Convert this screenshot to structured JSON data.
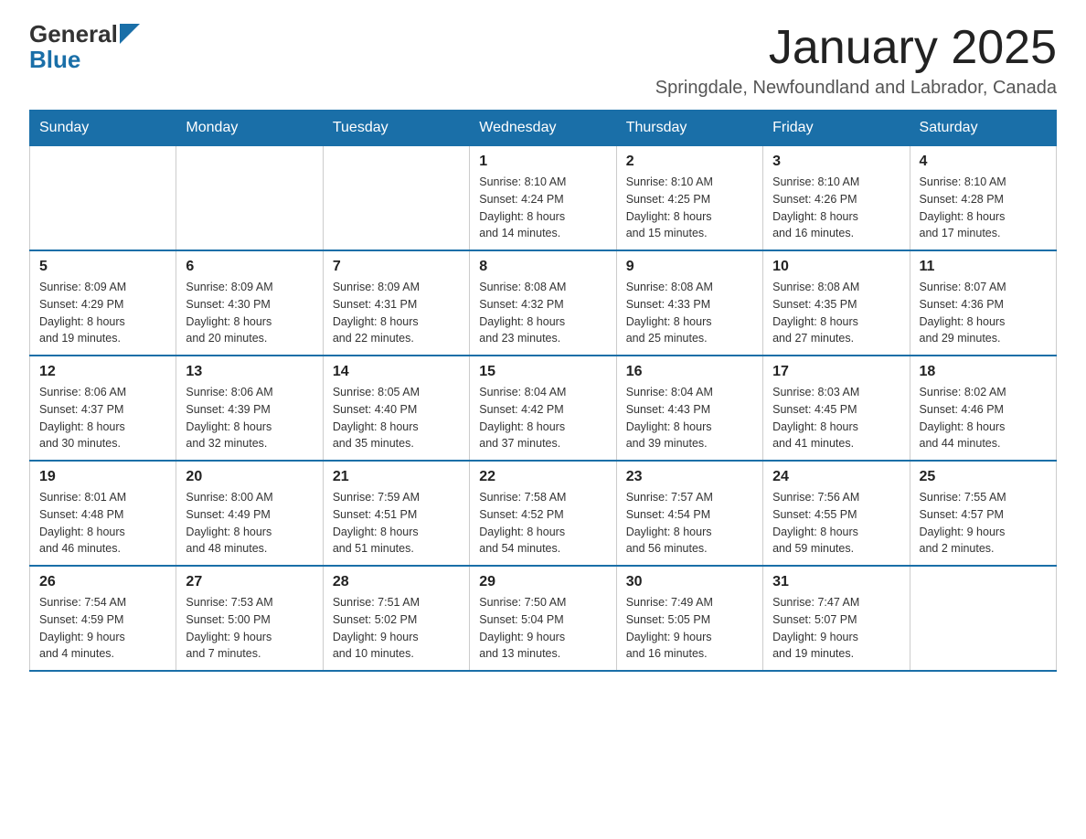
{
  "header": {
    "logo_general": "General",
    "logo_blue": "Blue",
    "month_title": "January 2025",
    "location": "Springdale, Newfoundland and Labrador, Canada"
  },
  "days_of_week": [
    "Sunday",
    "Monday",
    "Tuesday",
    "Wednesday",
    "Thursday",
    "Friday",
    "Saturday"
  ],
  "weeks": [
    {
      "days": [
        {
          "number": "",
          "info": ""
        },
        {
          "number": "",
          "info": ""
        },
        {
          "number": "",
          "info": ""
        },
        {
          "number": "1",
          "info": "Sunrise: 8:10 AM\nSunset: 4:24 PM\nDaylight: 8 hours\nand 14 minutes."
        },
        {
          "number": "2",
          "info": "Sunrise: 8:10 AM\nSunset: 4:25 PM\nDaylight: 8 hours\nand 15 minutes."
        },
        {
          "number": "3",
          "info": "Sunrise: 8:10 AM\nSunset: 4:26 PM\nDaylight: 8 hours\nand 16 minutes."
        },
        {
          "number": "4",
          "info": "Sunrise: 8:10 AM\nSunset: 4:28 PM\nDaylight: 8 hours\nand 17 minutes."
        }
      ]
    },
    {
      "days": [
        {
          "number": "5",
          "info": "Sunrise: 8:09 AM\nSunset: 4:29 PM\nDaylight: 8 hours\nand 19 minutes."
        },
        {
          "number": "6",
          "info": "Sunrise: 8:09 AM\nSunset: 4:30 PM\nDaylight: 8 hours\nand 20 minutes."
        },
        {
          "number": "7",
          "info": "Sunrise: 8:09 AM\nSunset: 4:31 PM\nDaylight: 8 hours\nand 22 minutes."
        },
        {
          "number": "8",
          "info": "Sunrise: 8:08 AM\nSunset: 4:32 PM\nDaylight: 8 hours\nand 23 minutes."
        },
        {
          "number": "9",
          "info": "Sunrise: 8:08 AM\nSunset: 4:33 PM\nDaylight: 8 hours\nand 25 minutes."
        },
        {
          "number": "10",
          "info": "Sunrise: 8:08 AM\nSunset: 4:35 PM\nDaylight: 8 hours\nand 27 minutes."
        },
        {
          "number": "11",
          "info": "Sunrise: 8:07 AM\nSunset: 4:36 PM\nDaylight: 8 hours\nand 29 minutes."
        }
      ]
    },
    {
      "days": [
        {
          "number": "12",
          "info": "Sunrise: 8:06 AM\nSunset: 4:37 PM\nDaylight: 8 hours\nand 30 minutes."
        },
        {
          "number": "13",
          "info": "Sunrise: 8:06 AM\nSunset: 4:39 PM\nDaylight: 8 hours\nand 32 minutes."
        },
        {
          "number": "14",
          "info": "Sunrise: 8:05 AM\nSunset: 4:40 PM\nDaylight: 8 hours\nand 35 minutes."
        },
        {
          "number": "15",
          "info": "Sunrise: 8:04 AM\nSunset: 4:42 PM\nDaylight: 8 hours\nand 37 minutes."
        },
        {
          "number": "16",
          "info": "Sunrise: 8:04 AM\nSunset: 4:43 PM\nDaylight: 8 hours\nand 39 minutes."
        },
        {
          "number": "17",
          "info": "Sunrise: 8:03 AM\nSunset: 4:45 PM\nDaylight: 8 hours\nand 41 minutes."
        },
        {
          "number": "18",
          "info": "Sunrise: 8:02 AM\nSunset: 4:46 PM\nDaylight: 8 hours\nand 44 minutes."
        }
      ]
    },
    {
      "days": [
        {
          "number": "19",
          "info": "Sunrise: 8:01 AM\nSunset: 4:48 PM\nDaylight: 8 hours\nand 46 minutes."
        },
        {
          "number": "20",
          "info": "Sunrise: 8:00 AM\nSunset: 4:49 PM\nDaylight: 8 hours\nand 48 minutes."
        },
        {
          "number": "21",
          "info": "Sunrise: 7:59 AM\nSunset: 4:51 PM\nDaylight: 8 hours\nand 51 minutes."
        },
        {
          "number": "22",
          "info": "Sunrise: 7:58 AM\nSunset: 4:52 PM\nDaylight: 8 hours\nand 54 minutes."
        },
        {
          "number": "23",
          "info": "Sunrise: 7:57 AM\nSunset: 4:54 PM\nDaylight: 8 hours\nand 56 minutes."
        },
        {
          "number": "24",
          "info": "Sunrise: 7:56 AM\nSunset: 4:55 PM\nDaylight: 8 hours\nand 59 minutes."
        },
        {
          "number": "25",
          "info": "Sunrise: 7:55 AM\nSunset: 4:57 PM\nDaylight: 9 hours\nand 2 minutes."
        }
      ]
    },
    {
      "days": [
        {
          "number": "26",
          "info": "Sunrise: 7:54 AM\nSunset: 4:59 PM\nDaylight: 9 hours\nand 4 minutes."
        },
        {
          "number": "27",
          "info": "Sunrise: 7:53 AM\nSunset: 5:00 PM\nDaylight: 9 hours\nand 7 minutes."
        },
        {
          "number": "28",
          "info": "Sunrise: 7:51 AM\nSunset: 5:02 PM\nDaylight: 9 hours\nand 10 minutes."
        },
        {
          "number": "29",
          "info": "Sunrise: 7:50 AM\nSunset: 5:04 PM\nDaylight: 9 hours\nand 13 minutes."
        },
        {
          "number": "30",
          "info": "Sunrise: 7:49 AM\nSunset: 5:05 PM\nDaylight: 9 hours\nand 16 minutes."
        },
        {
          "number": "31",
          "info": "Sunrise: 7:47 AM\nSunset: 5:07 PM\nDaylight: 9 hours\nand 19 minutes."
        },
        {
          "number": "",
          "info": ""
        }
      ]
    }
  ]
}
